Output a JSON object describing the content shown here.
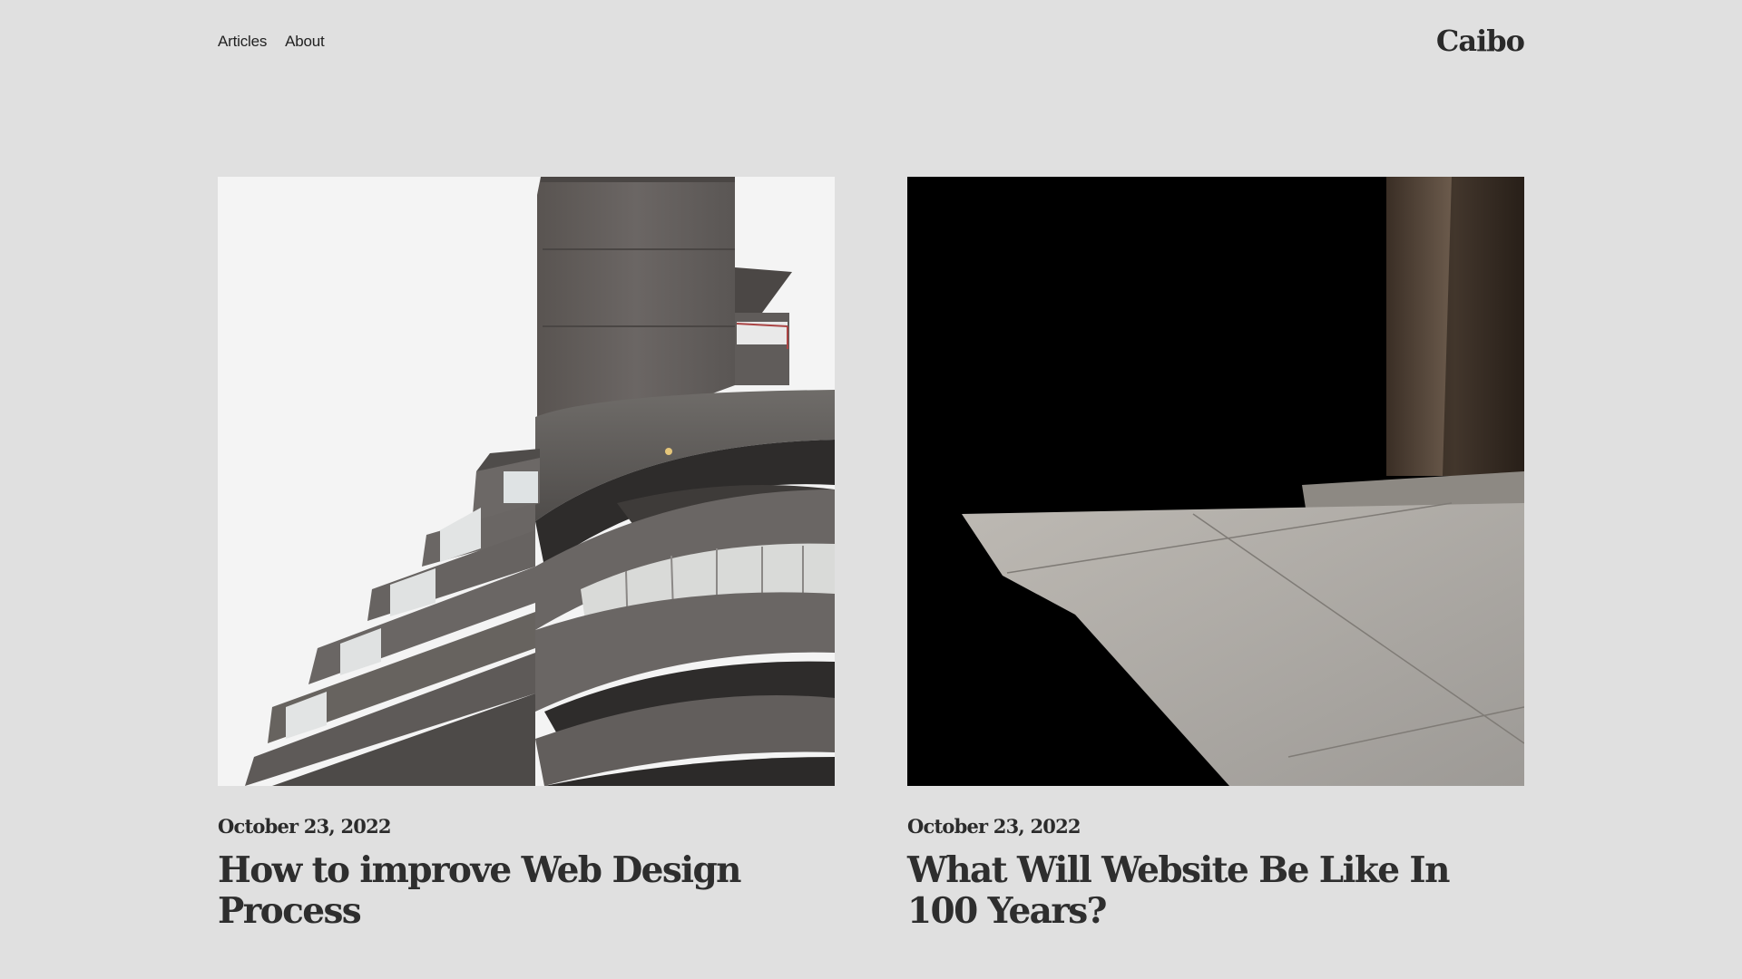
{
  "header": {
    "nav": [
      {
        "label": "Articles"
      },
      {
        "label": "About"
      }
    ],
    "logo": "Caibo"
  },
  "articles": [
    {
      "date": "October 23, 2022",
      "title": "How to improve Web Design Process",
      "image": "brutalist-building-photo"
    },
    {
      "date": "October 23, 2022",
      "title": "What Will Website Be Like In 100 Years?",
      "image": "concrete-shadow-photo"
    }
  ]
}
